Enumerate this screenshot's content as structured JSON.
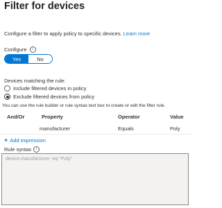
{
  "panel": {
    "title": "Filter for devices",
    "description": "Configure a filter to apply policy to specific devices.",
    "learn_more": "Learn more"
  },
  "configure": {
    "label": "Configure",
    "info_icon": "info-icon",
    "options": [
      "Yes",
      "No"
    ],
    "selected": "Yes"
  },
  "rule": {
    "label": "Devices matching the rule:",
    "options": [
      {
        "label": "Include filtered devices in policy",
        "checked": false
      },
      {
        "label": "Exclude filtered devices from policy",
        "checked": true
      }
    ]
  },
  "hint": "You can use the rule builder or rule syntax text box to create or edit the filter rule.",
  "table": {
    "headers": [
      "And/Or",
      "Property",
      "Operator",
      "Value"
    ],
    "rows": [
      {
        "andor": "",
        "property": "manufacturer",
        "operator": "Equals",
        "value": "Poly"
      }
    ]
  },
  "add_expression": {
    "icon": "plus-icon",
    "label": "Add expression"
  },
  "rule_syntax": {
    "label": "Rule syntax",
    "info_icon": "info-icon",
    "value": "device.manufacturer -eq \"Poly\""
  },
  "colors": {
    "accent": "#0078d4",
    "text": "#323130",
    "disabled_bg": "#f3f2f1"
  }
}
